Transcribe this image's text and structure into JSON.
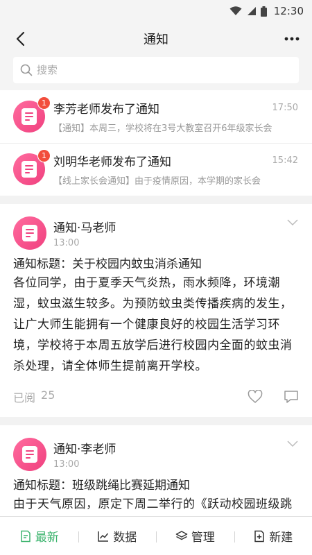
{
  "status_bar": {
    "time": "12:30"
  },
  "nav": {
    "title": "通知"
  },
  "search": {
    "placeholder": "搜索"
  },
  "messages": [
    {
      "title": "李芳老师发布了通知",
      "time": "17:50",
      "preview": "【通知】本周三，学校将在3号大教室召开6年级家长会",
      "badge": "1"
    },
    {
      "title": "刘明华老师发布了通知",
      "time": "15:42",
      "preview": "【线上家长会通知】由于疫情原因，本学期的家长会",
      "badge": "1"
    }
  ],
  "posts": [
    {
      "author": "通知·马老师",
      "time": "13:00",
      "subject": "通知标题：关于校园内蚊虫消杀通知",
      "content": "各位同学，由于夏季天气炎热，雨水频降，环境潮湿，蚊虫滋生较多。为预防蚊虫类传播疾病的发生，让广大师生能拥有一个健康良好的校园生活学习环境，学校将于本周五放学后进行校园内全面的蚊虫消杀处理，请全体师生提前离开学校。",
      "read_label": "已阅",
      "read_count": "25"
    },
    {
      "author": "通知·李老师",
      "time": "13:00",
      "subject": "通知标题：班级跳绳比赛延期通知",
      "content": "由于天气原因，原定下周二举行的《跃动校园班级跳绳比赛》将暂时取消，比赛具体举办时间将另行通知。"
    }
  ],
  "tabs": [
    {
      "label": "最新",
      "icon": "edit-doc-icon",
      "active": true
    },
    {
      "label": "数据",
      "icon": "chart-icon",
      "active": false
    },
    {
      "label": "管理",
      "icon": "layers-icon",
      "active": false
    },
    {
      "label": "新建",
      "icon": "new-doc-icon",
      "active": false
    }
  ],
  "colors": {
    "accent": "#3cb46e",
    "avatar": "#f0417f",
    "badge": "#f24d3c"
  }
}
